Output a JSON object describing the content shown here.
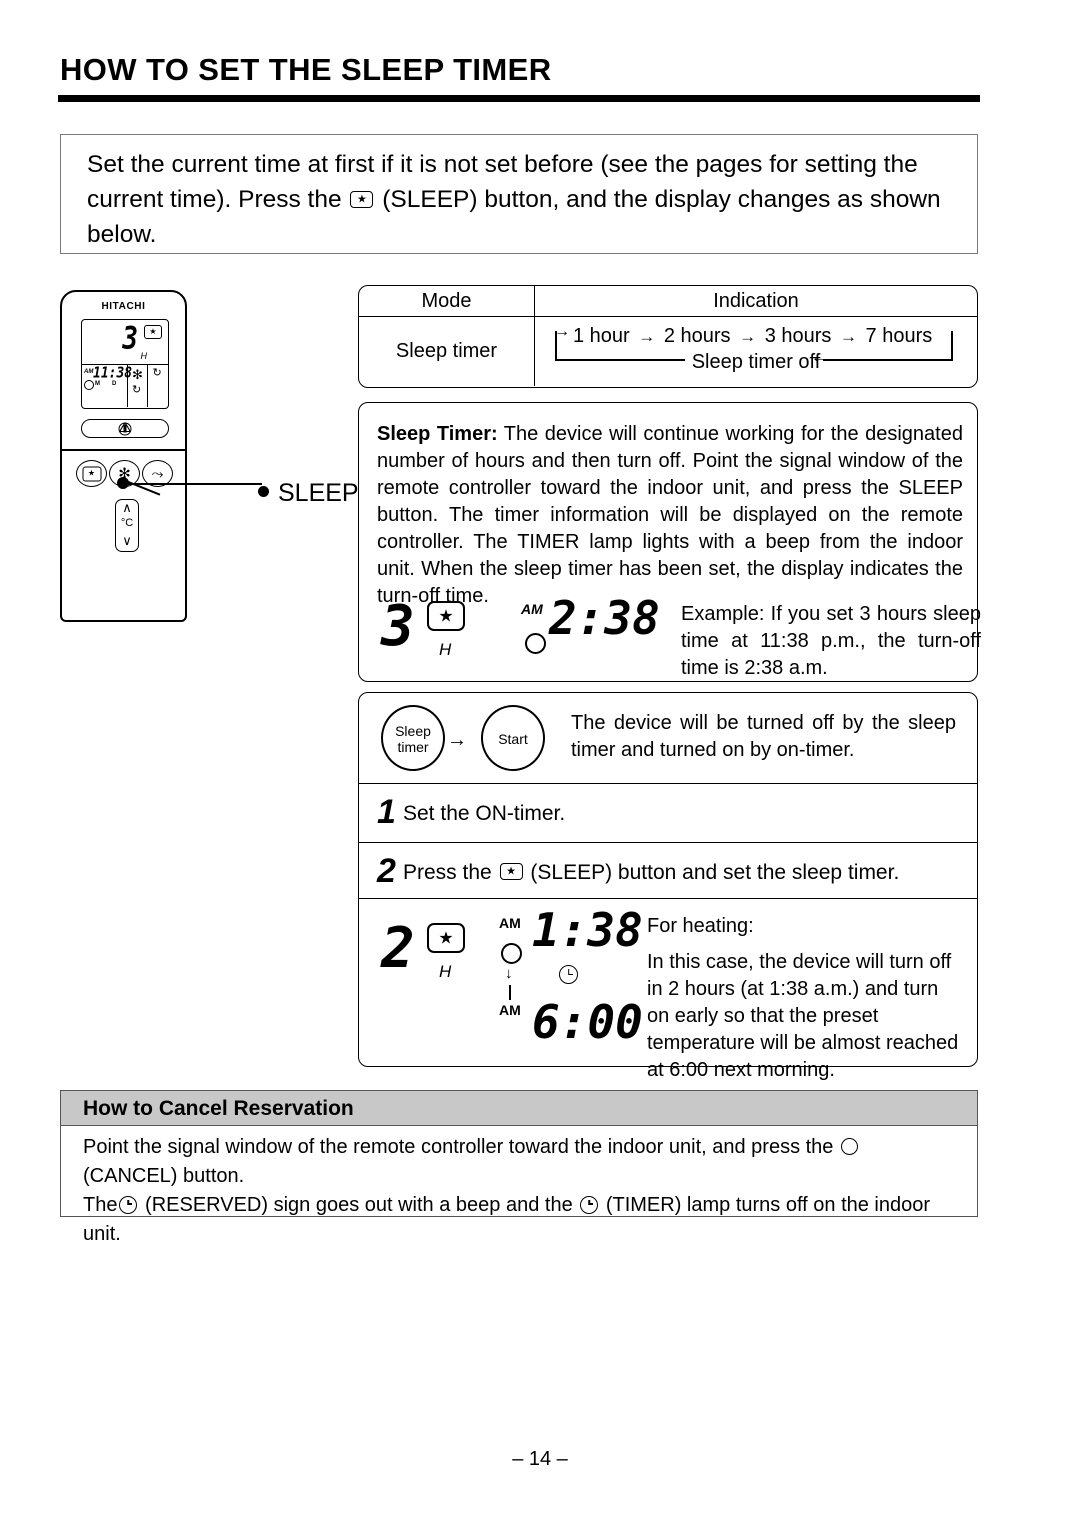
{
  "page": {
    "title": "HOW TO SET THE SLEEP TIMER",
    "footer": "– 14 –"
  },
  "intro": {
    "part1": "Set the current time at first if it is not set before (see the pages for setting the current time). Press the",
    "part2": "(SLEEP) button, and the display changes as shown below."
  },
  "remote": {
    "brand": "HITACHI",
    "lcd": {
      "hours": "3",
      "hour_unit": "H",
      "am_label": "AM",
      "time": "11:38",
      "m_label": "M",
      "d_label": "D",
      "fan_icon": "✻",
      "rotate_icon": "↻",
      "rotate_icon2": "↻"
    },
    "callout_label": "SLEEP",
    "temp": {
      "up": "∧",
      "unit": "°C",
      "down": "∨"
    },
    "buttons": {
      "fan_glyph": "✻",
      "swing_glyph": "⤳"
    }
  },
  "mode_table": {
    "header_mode": "Mode",
    "header_indication": "Indication",
    "row_label": "Sleep timer",
    "cycle": [
      "1 hour",
      "2 hours",
      "3 hours",
      "7 hours"
    ],
    "cycle_off": "Sleep timer off",
    "arrow": "→"
  },
  "description": {
    "bold_lead": "Sleep Timer:",
    "body": " The device will continue working for the designated number of hours and then turn off. Point the signal window of the remote controller toward the indoor unit, and press the SLEEP button. The timer information will be displayed on the remote controller. The TIMER lamp lights with a beep from the indoor unit. When the sleep timer has been set, the display indicates the turn-off time."
  },
  "example_display": {
    "hours": "3",
    "hour_unit": "H",
    "am_label": "AM",
    "time": "2:38",
    "note": "Example: If you set 3 hours sleep time at 11:38 p.m., the turn-off time is 2:38 a.m."
  },
  "steps": {
    "ellipse_sleep": "Sleep\ntimer",
    "ellipse_sleep_line1": "Sleep",
    "ellipse_sleep_line2": "timer",
    "ellipse_start": "Start",
    "ellipse_arrow": "→",
    "row0_text": "The device will be turned off by the sleep timer and turned on by on-timer.",
    "step1_num": "1",
    "step1_text": "Set the ON-timer.",
    "step2_num": "2",
    "step2_text_a": "Press the",
    "step2_text_b": "(SLEEP) button and set the sleep timer."
  },
  "heating_example": {
    "hours": "2",
    "hour_unit": "H",
    "am_label_top": "AM",
    "time_top": "1:38",
    "am_label_bottom": "AM",
    "time_bottom": "6:00",
    "down_arrow": "↓",
    "title": "For heating:",
    "body": "In this case, the device will turn off in 2 hours (at 1:38 a.m.) and turn on early so that the preset temperature will be almost reached at 6:00 next morning."
  },
  "cancel": {
    "header": "How to Cancel Reservation",
    "line1_a": "Point the signal window of the remote controller toward the indoor unit, and press the",
    "line1_b": "(CANCEL) button.",
    "line2_a": "The",
    "line2_b": "(RESERVED) sign goes out with a beep and the",
    "line2_c": "(TIMER) lamp turns off on the indoor unit."
  },
  "colors": {
    "header_gray": "#c8c8c8",
    "rule_black": "#000000"
  }
}
